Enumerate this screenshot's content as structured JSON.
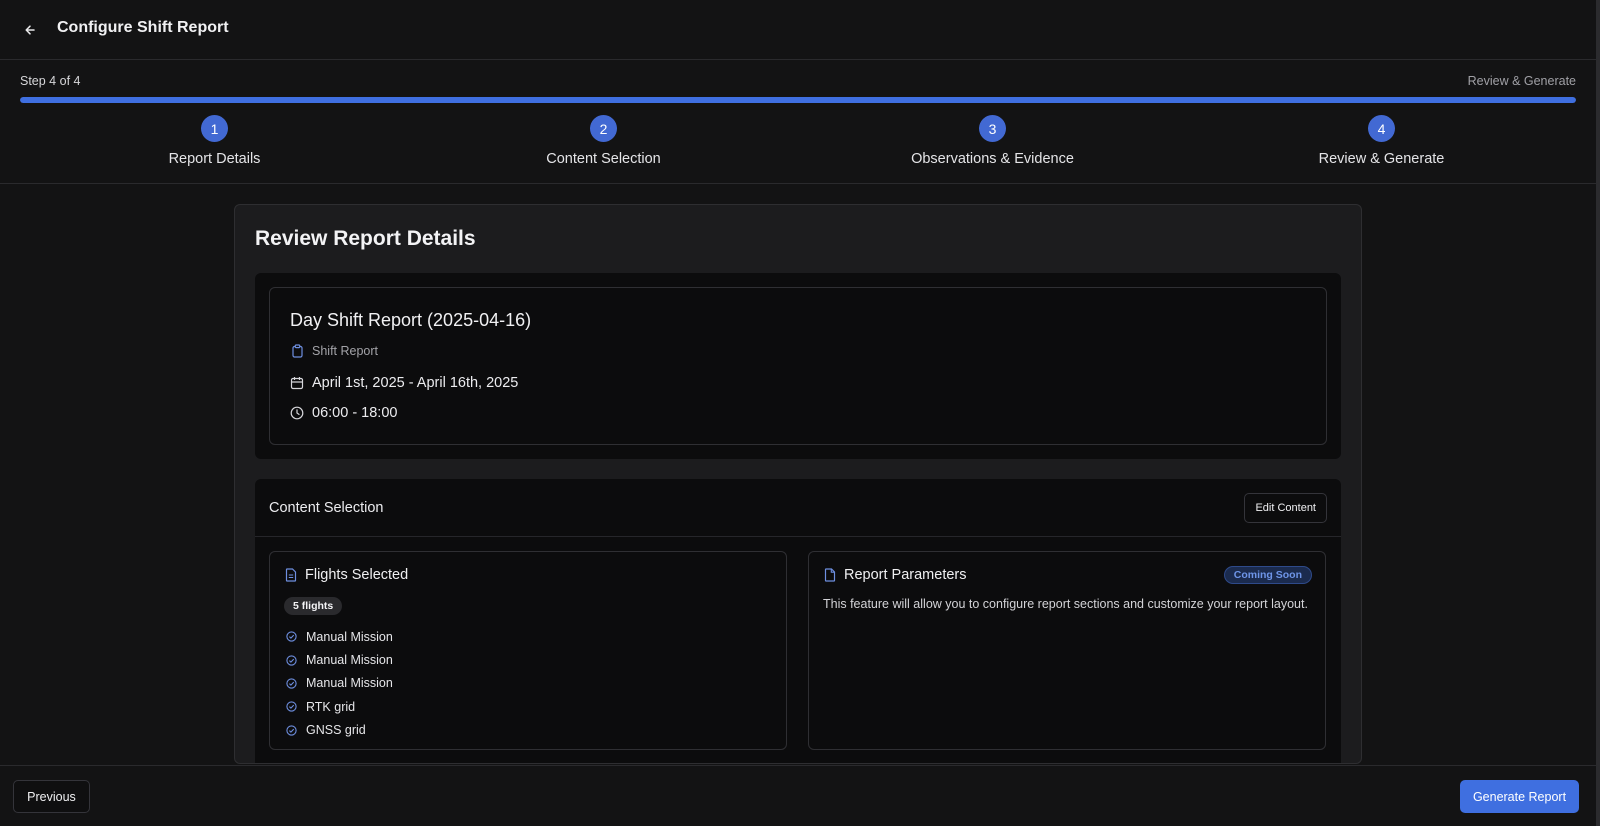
{
  "header": {
    "title": "Configure Shift Report",
    "back_icon": "arrow-left-icon"
  },
  "progress": {
    "step_count": "Step 4 of 4",
    "current_step_name": "Review & Generate",
    "percent": 100,
    "color": "#3f6fe0"
  },
  "steps": [
    {
      "number": "1",
      "label": "Report Details"
    },
    {
      "number": "2",
      "label": "Content Selection"
    },
    {
      "number": "3",
      "label": "Observations & Evidence"
    },
    {
      "number": "4",
      "label": "Review & Generate"
    }
  ],
  "main": {
    "title": "Review Report Details",
    "details": {
      "title": "Day Shift Report (2025-04-16)",
      "type": "Shift Report",
      "date_range": "April 1st, 2025 - April 16th, 2025",
      "time_range": "06:00 - 18:00"
    },
    "content": {
      "title": "Content Selection",
      "edit_label": "Edit Content",
      "flights": {
        "title": "Flights Selected",
        "count_badge": "5 flights",
        "items": [
          "Manual Mission",
          "Manual Mission",
          "Manual Mission",
          "RTK grid",
          "GNSS grid"
        ]
      },
      "parameters": {
        "title": "Report Parameters",
        "badge": "Coming Soon",
        "description": "This feature will allow you to configure report sections and customize your report layout."
      }
    }
  },
  "footer": {
    "previous_label": "Previous",
    "generate_label": "Generate Report"
  },
  "colors": {
    "accent": "#3f6fe0",
    "step_circle": "#4269d3",
    "background": "#131314"
  }
}
